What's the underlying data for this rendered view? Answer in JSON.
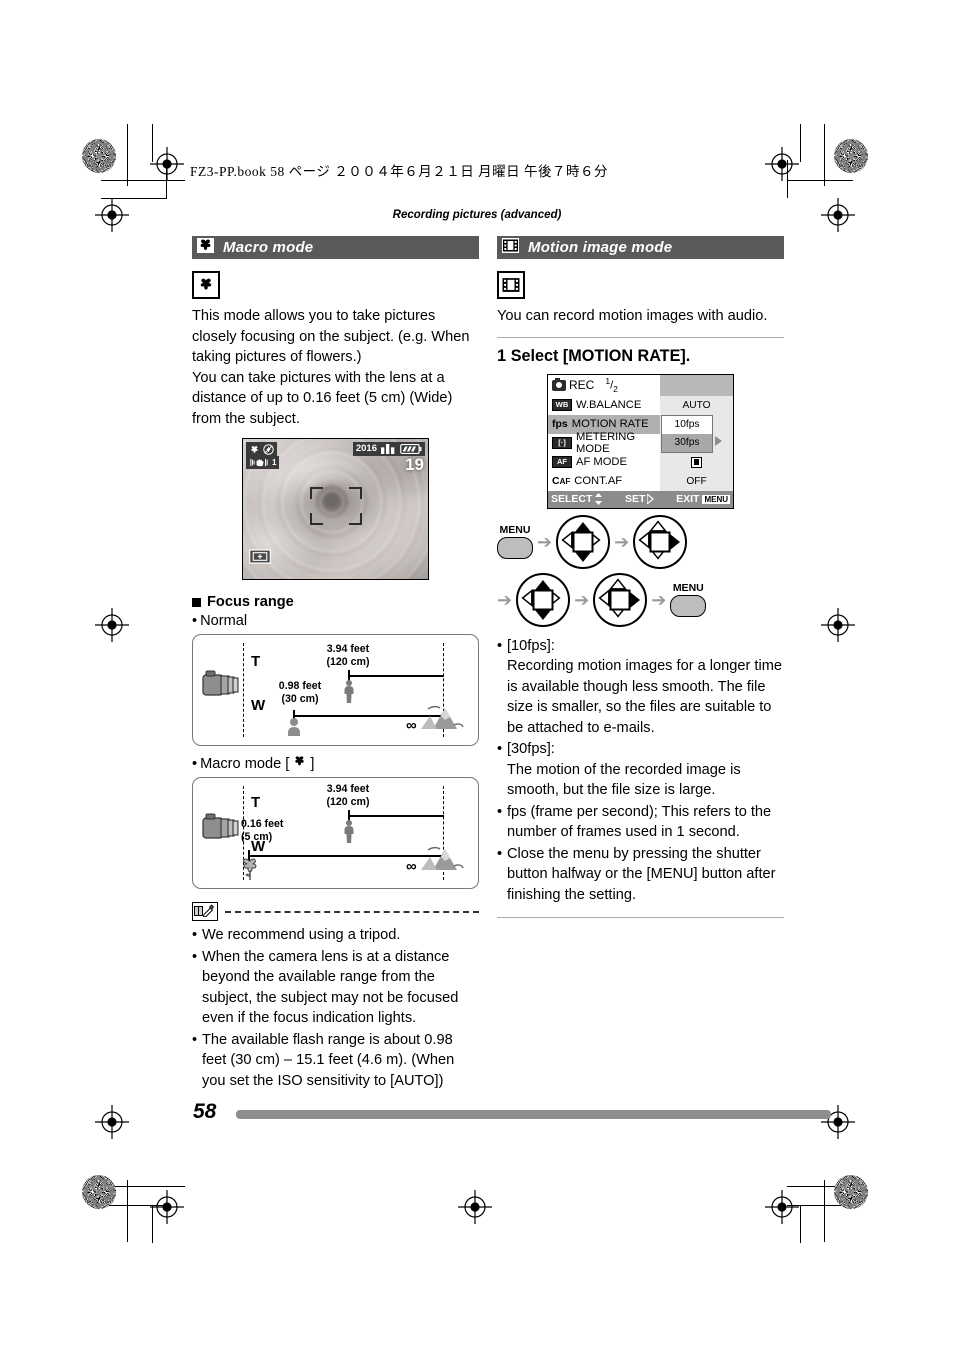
{
  "print": {
    "book_line": "FZ3-PP.book   58 ページ   ２００４年６月２１日   月曜日   午後７時６分",
    "running_head": "Recording pictures (advanced)",
    "page_number": "58"
  },
  "left_column": {
    "section": {
      "icon": "macro-flower-icon",
      "title": "Macro mode"
    },
    "mode_icon": "macro-flower-icon",
    "paragraphs": [
      "This mode allows you to take pictures closely focusing on the subject. (e.g. When taking pictures of flowers.)",
      "You can take pictures with the lens at a distance of up to 0.16 feet (5 cm) (Wide) from the subject."
    ],
    "lcd_preview": {
      "icons": [
        "macro-flower-icon",
        "flash-off-icon",
        "image-stabilizer-icon"
      ],
      "stabilizer_value": "1",
      "resolution": "2016",
      "quality_icon": "quality-fine-icon",
      "battery_icon": "battery-icon",
      "remaining_shots": "19",
      "af_area": "af-frame",
      "metering_icon": "spot-metering-icon"
    },
    "focus_range": {
      "heading": "Focus range",
      "figures": [
        {
          "label": "Normal",
          "label_icon": null,
          "tele_label": "T",
          "wide_label": "W",
          "tele_distance": "3.94 feet",
          "tele_distance_metric": "(120 cm)",
          "wide_distance": "0.98 feet",
          "wide_distance_metric": "(30 cm)",
          "infinity": "∞",
          "tele_subject": "person-icon",
          "wide_subject": "person-icon"
        },
        {
          "label": "Macro mode [",
          "label_icon": "macro-flower-icon",
          "label_end": "]",
          "tele_label": "T",
          "wide_label": "W",
          "tele_distance": "3.94 feet",
          "tele_distance_metric": "(120 cm)",
          "wide_distance": "0.16 feet",
          "wide_distance_metric": "(5 cm)",
          "infinity": "∞",
          "tele_subject": "person-icon",
          "wide_subject": "flower-icon"
        }
      ]
    },
    "notes": [
      "We recommend using a tripod.",
      "When the camera lens is at a distance beyond the available range from the subject, the subject may not be focused even if the focus indication lights.",
      "The available flash range is about 0.98 feet (30 cm) – 15.1 feet (4.6 m). (When you set the ISO sensitivity to [AUTO])"
    ]
  },
  "right_column": {
    "section": {
      "icon": "film-strip-icon",
      "title": "Motion image mode"
    },
    "mode_icon": "film-strip-icon",
    "intro": "You can record motion images with audio.",
    "step": {
      "number": "1",
      "title": "Select [MOTION RATE]."
    },
    "menu_screen": {
      "header_icon": "rec-camera-icon",
      "header_title": "REC",
      "page_indicator": "1/2",
      "page_current": "1",
      "page_total": "2",
      "rows": [
        {
          "tag": "WB",
          "tag_style": "box",
          "label": "W.BALANCE",
          "value": "AUTO",
          "selected": false
        },
        {
          "tag": "fps",
          "tag_style": "plain",
          "label": "MOTION RATE",
          "value": "10fps",
          "selected": true
        },
        {
          "tag": "[·]",
          "tag_style": "box",
          "label": "METERING MODE",
          "value": "30fps",
          "selected": false
        },
        {
          "tag": "AF",
          "tag_style": "box",
          "label": "AF MODE",
          "value": "■",
          "selected": false
        },
        {
          "tag": "CAF",
          "tag_style": "plain",
          "label": "CONT.AF",
          "value": "OFF",
          "selected": false
        }
      ],
      "popup_options": [
        {
          "label": "10fps",
          "highlighted": false
        },
        {
          "label": "30fps",
          "highlighted": true
        }
      ],
      "footer": {
        "select_label": "SELECT",
        "select_icon": "up-down-arrows-icon",
        "set_label": "SET",
        "set_icon": "right-arrow-icon",
        "exit_label": "EXIT",
        "exit_button": "MENU"
      }
    },
    "flow_diagram": {
      "menu_label_start": "MENU",
      "menu_label_end": "MENU",
      "steps": [
        "menu-button",
        "cursor-pad-up-down",
        "cursor-pad-right",
        "cursor-pad-up-down",
        "cursor-pad-right",
        "menu-button"
      ]
    },
    "notes": [
      "[10fps]:",
      "Recording motion images for a longer time is available though less smooth. The file size is smaller, so the files are suitable to be attached to e-mails.",
      "[30fps]:",
      "The motion of the recorded image is smooth, but the file size is large.",
      "fps (frame per second); This refers to the number of frames used in 1 second.",
      "Close the menu by pressing the shutter button halfway or the [MENU] button after finishing the setting."
    ]
  },
  "colors": {
    "section_bar": "#5a5a5a",
    "footer_bar": "#8d8d8d",
    "menu_selected": "#b0b0b0",
    "menu_footer": "#8c8c8c"
  }
}
